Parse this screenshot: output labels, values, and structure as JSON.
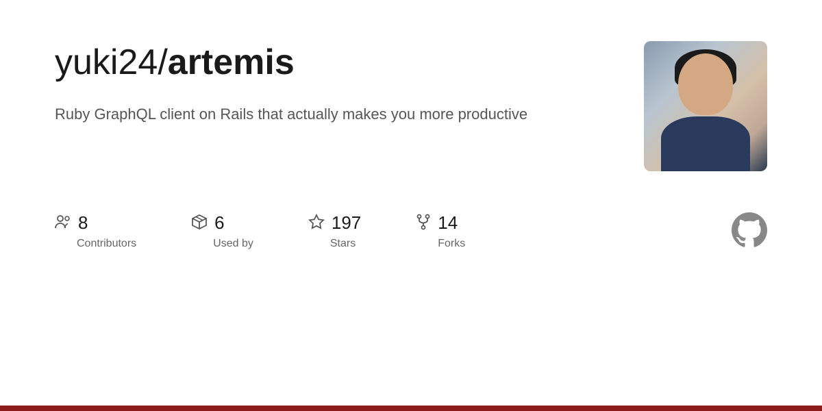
{
  "header": {
    "repo_owner": "yuki24/",
    "repo_name": "artemis",
    "description": "Ruby GraphQL client on Rails that actually makes you more productive"
  },
  "stats": [
    {
      "id": "contributors",
      "number": "8",
      "label": "Contributors",
      "icon": "people-icon"
    },
    {
      "id": "used-by",
      "number": "6",
      "label": "Used by",
      "icon": "package-icon"
    },
    {
      "id": "stars",
      "number": "197",
      "label": "Stars",
      "icon": "star-icon"
    },
    {
      "id": "forks",
      "number": "14",
      "label": "Forks",
      "icon": "fork-icon"
    }
  ],
  "github": {
    "icon_label": "GitHub"
  }
}
